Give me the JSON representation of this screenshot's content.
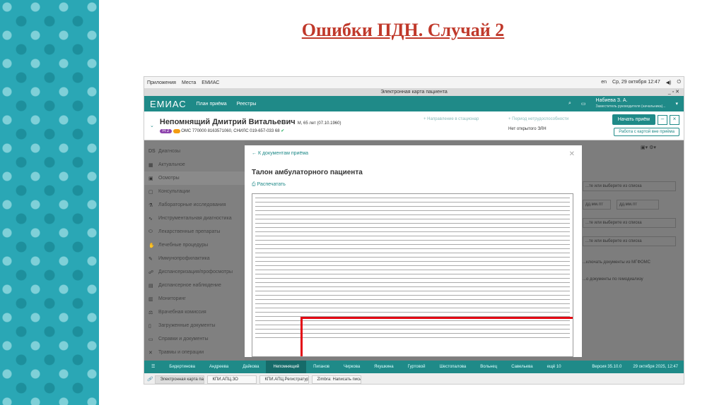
{
  "slide": {
    "title": "Ошибки ПДН. Случай 2"
  },
  "os": {
    "menu": [
      "Приложения",
      "Места"
    ],
    "app": "ЕМИАС",
    "lang": "en",
    "datetime": "Ср, 29 октября 12:47"
  },
  "window": {
    "title": "Электронная карта пациента"
  },
  "appbar": {
    "logo": "ЕМИАС",
    "nav": [
      "План приёма",
      "Реестры"
    ],
    "user_name": "Набиева З. А.",
    "user_role": "Заместитель руководителя (начальника)..."
  },
  "patient": {
    "name": "Непомнящий Дмитрий Витальевич",
    "info": "М, 65 лет (07.10.1960)",
    "badge1": "Н 2",
    "ids": "ОМС 770000 8163571060, СНИЛС 019-657-033 68",
    "referral": "+ Направление в стационар",
    "disability": "+ Период нетрудоспособности",
    "no_eln": "Нет открытого ЭЛН",
    "start_btn": "Начать приём",
    "card_btn": "Работа с картой вне приёма"
  },
  "sidebar": {
    "items": [
      "Диагнозы",
      "Актуальное",
      "Осмотры",
      "Консультации",
      "Лабораторные исследования",
      "Инструментальная диагностика",
      "Лекарственные препараты",
      "Лечебные процедуры",
      "Иммунопрофилактика",
      "Диспансеризация/профосмотры",
      "Диспансерное наблюдение",
      "Мониторинг",
      "Врачебная комиссия",
      "Загруженные документы",
      "Справки и документы",
      "Травмы и операции"
    ]
  },
  "right": {
    "placeholder": "...те или выберите из списка",
    "date": "дд.мм.ггг",
    "opt1": "...ключать документы из МГФОМС",
    "opt2": "...о документы по гемодиализу"
  },
  "modal": {
    "back": "К документам приёма",
    "title": "Талон амбулаторного пациента",
    "print": "Распечатать"
  },
  "tabs": {
    "items": [
      "Бидертинова",
      "Андреева",
      "Дайкова",
      "Непомнящий",
      "Пиганов",
      "Чиркова",
      "Якушкина",
      "Гуртовой",
      "Шестопалова",
      "Вольнец",
      "Савельева",
      "ещё 10"
    ],
    "version": "Версия 35.10.0",
    "datetime": "29 октября 2025, 12:47"
  },
  "taskbar": {
    "items": [
      "Электронная карта пациента",
      "КПИ.АПЦ.ЗО",
      "КПИ.АПЦ.Регистратура",
      "Zimbra: Написать письмо"
    ]
  }
}
